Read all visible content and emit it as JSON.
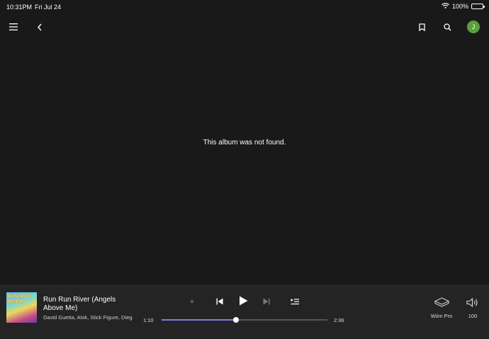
{
  "status_bar": {
    "time": "10:31PM",
    "date": "Fri Jul 24",
    "battery": "100%"
  },
  "nav": {
    "avatar_initial": "J"
  },
  "main": {
    "message": "This album was not found."
  },
  "player": {
    "album_art_text": "RUN RUN RIVER",
    "track_title": "Run Run River (Angels Above Me)",
    "track_artist": "David Guetta, Alok, Stick Figure, Diego",
    "elapsed": "1:10",
    "total": "2:36",
    "progress": 0.45,
    "device_name": "Wiim Pro",
    "volume": "100"
  },
  "colors": {
    "background": "#191919",
    "player_bg": "#242424",
    "accent": "#7b7fe8",
    "avatar": "#5aa03a"
  }
}
